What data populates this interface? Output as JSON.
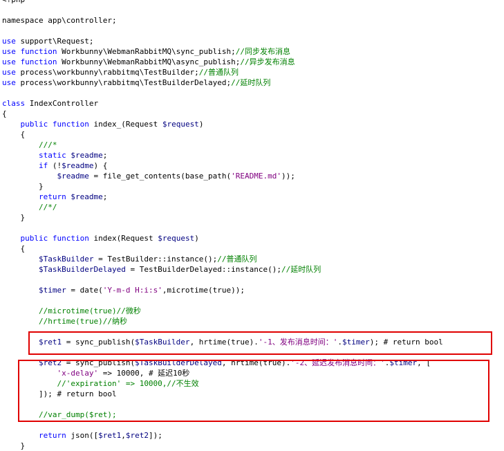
{
  "editor": {
    "lines": [
      {
        "tokens": [
          [
            "plain",
            "<?php"
          ]
        ]
      },
      {
        "tokens": []
      },
      {
        "tokens": [
          [
            "plain",
            "namespace app\\controller;"
          ]
        ]
      },
      {
        "tokens": []
      },
      {
        "tokens": [
          [
            "kw",
            "use"
          ],
          [
            "plain",
            " support\\Request;"
          ]
        ]
      },
      {
        "tokens": [
          [
            "kw",
            "use"
          ],
          [
            "plain",
            " "
          ],
          [
            "kw",
            "function"
          ],
          [
            "plain",
            " Workbunny\\WebmanRabbitMQ\\sync_publish;"
          ],
          [
            "cmt",
            "//同步发布消息"
          ]
        ]
      },
      {
        "tokens": [
          [
            "kw",
            "use"
          ],
          [
            "plain",
            " "
          ],
          [
            "kw",
            "function"
          ],
          [
            "plain",
            " Workbunny\\WebmanRabbitMQ\\async_publish;"
          ],
          [
            "cmt",
            "//异步发布消息"
          ]
        ]
      },
      {
        "tokens": [
          [
            "kw",
            "use"
          ],
          [
            "plain",
            " process\\workbunny\\rabbitmq\\TestBuilder;"
          ],
          [
            "cmt",
            "//普通队列"
          ]
        ]
      },
      {
        "tokens": [
          [
            "kw",
            "use"
          ],
          [
            "plain",
            " process\\workbunny\\rabbitmq\\TestBuilderDelayed;"
          ],
          [
            "cmt",
            "//延时队列"
          ]
        ]
      },
      {
        "tokens": []
      },
      {
        "tokens": [
          [
            "kw",
            "class"
          ],
          [
            "plain",
            " IndexController"
          ]
        ]
      },
      {
        "tokens": [
          [
            "plain",
            "{"
          ]
        ]
      },
      {
        "tokens": [
          [
            "plain",
            "    "
          ],
          [
            "kw",
            "public"
          ],
          [
            "plain",
            " "
          ],
          [
            "kw",
            "function"
          ],
          [
            "plain",
            " index_(Request "
          ],
          [
            "var",
            "$request"
          ],
          [
            "plain",
            ")"
          ]
        ]
      },
      {
        "tokens": [
          [
            "plain",
            "    {"
          ]
        ]
      },
      {
        "tokens": [
          [
            "plain",
            "        "
          ],
          [
            "cmt",
            "///*"
          ]
        ]
      },
      {
        "tokens": [
          [
            "plain",
            "        "
          ],
          [
            "kw",
            "static"
          ],
          [
            "plain",
            " "
          ],
          [
            "var",
            "$readme"
          ],
          [
            "plain",
            ";"
          ]
        ]
      },
      {
        "tokens": [
          [
            "plain",
            "        "
          ],
          [
            "kw",
            "if"
          ],
          [
            "plain",
            " (!"
          ],
          [
            "var",
            "$readme"
          ],
          [
            "plain",
            ") {"
          ]
        ]
      },
      {
        "tokens": [
          [
            "plain",
            "            "
          ],
          [
            "var",
            "$readme"
          ],
          [
            "plain",
            " = file_get_contents(base_path("
          ],
          [
            "str",
            "'README.md'"
          ],
          [
            "plain",
            "));"
          ]
        ]
      },
      {
        "tokens": [
          [
            "plain",
            "        }"
          ]
        ]
      },
      {
        "tokens": [
          [
            "plain",
            "        "
          ],
          [
            "kw",
            "return"
          ],
          [
            "plain",
            " "
          ],
          [
            "var",
            "$readme"
          ],
          [
            "plain",
            ";"
          ]
        ]
      },
      {
        "tokens": [
          [
            "plain",
            "        "
          ],
          [
            "cmt",
            "//*/"
          ]
        ]
      },
      {
        "tokens": [
          [
            "plain",
            "    }"
          ]
        ]
      },
      {
        "tokens": []
      },
      {
        "tokens": [
          [
            "plain",
            "    "
          ],
          [
            "kw",
            "public"
          ],
          [
            "plain",
            " "
          ],
          [
            "kw",
            "function"
          ],
          [
            "plain",
            " index(Request "
          ],
          [
            "var",
            "$request"
          ],
          [
            "plain",
            ")"
          ]
        ]
      },
      {
        "tokens": [
          [
            "plain",
            "    {"
          ]
        ]
      },
      {
        "tokens": [
          [
            "plain",
            "        "
          ],
          [
            "var",
            "$TaskBuilder"
          ],
          [
            "plain",
            " = TestBuilder::instance();"
          ],
          [
            "cmt",
            "//普通队列"
          ]
        ]
      },
      {
        "tokens": [
          [
            "plain",
            "        "
          ],
          [
            "var",
            "$TaskBuilderDelayed"
          ],
          [
            "plain",
            " = TestBuilderDelayed::instance();"
          ],
          [
            "cmt",
            "//延时队列"
          ]
        ]
      },
      {
        "tokens": []
      },
      {
        "tokens": [
          [
            "plain",
            "        "
          ],
          [
            "var",
            "$timer"
          ],
          [
            "plain",
            " = date("
          ],
          [
            "str",
            "'Y-m-d H:i:s'"
          ],
          [
            "plain",
            ",microtime(true));"
          ]
        ]
      },
      {
        "tokens": []
      },
      {
        "tokens": [
          [
            "plain",
            "        "
          ],
          [
            "cmt",
            "//microtime(true)//微秒"
          ]
        ]
      },
      {
        "tokens": [
          [
            "plain",
            "        "
          ],
          [
            "cmt",
            "//hrtime(true)//纳秒"
          ]
        ]
      },
      {
        "tokens": []
      },
      {
        "tokens": [
          [
            "plain",
            "        "
          ],
          [
            "var",
            "$ret1"
          ],
          [
            "plain",
            " = sync_publish("
          ],
          [
            "var",
            "$TaskBuilder"
          ],
          [
            "plain",
            ", hrtime(true)."
          ],
          [
            "str",
            "'-1、发布消息时间：'"
          ],
          [
            "plain",
            "."
          ],
          [
            "var",
            "$timer"
          ],
          [
            "plain",
            "); # return bool"
          ]
        ]
      },
      {
        "tokens": []
      },
      {
        "tokens": [
          [
            "plain",
            "        "
          ],
          [
            "var",
            "$ret2"
          ],
          [
            "plain",
            " = sync_publish("
          ],
          [
            "var",
            "$TaskBuilderDelayed"
          ],
          [
            "plain",
            ", hrtime(true)."
          ],
          [
            "str",
            "'-2、延迟发布消息时间：'"
          ],
          [
            "plain",
            "."
          ],
          [
            "var",
            "$timer"
          ],
          [
            "plain",
            ", ["
          ]
        ]
      },
      {
        "tokens": [
          [
            "plain",
            "            "
          ],
          [
            "str",
            "'x-delay'"
          ],
          [
            "plain",
            " => 10000, # 延迟10秒"
          ]
        ]
      },
      {
        "tokens": [
          [
            "plain",
            "            "
          ],
          [
            "cmt",
            "//'expiration' => 10000,//不生效"
          ]
        ]
      },
      {
        "tokens": [
          [
            "plain",
            "        ]); # return bool"
          ]
        ]
      },
      {
        "tokens": []
      },
      {
        "tokens": [
          [
            "plain",
            "        "
          ],
          [
            "cmt",
            "//var_dump($ret);"
          ]
        ]
      },
      {
        "tokens": []
      },
      {
        "tokens": [
          [
            "plain",
            "        "
          ],
          [
            "kw",
            "return"
          ],
          [
            "plain",
            " json(["
          ],
          [
            "var",
            "$ret1"
          ],
          [
            "plain",
            ","
          ],
          [
            "var",
            "$ret2"
          ],
          [
            "plain",
            "]);"
          ]
        ]
      },
      {
        "tokens": [
          [
            "plain",
            "    }"
          ]
        ]
      }
    ]
  },
  "colors": {
    "keyword": "#0000ff",
    "variable": "#000080",
    "string": "#800080",
    "comment": "#008000",
    "highlight_border": "#e00000"
  }
}
